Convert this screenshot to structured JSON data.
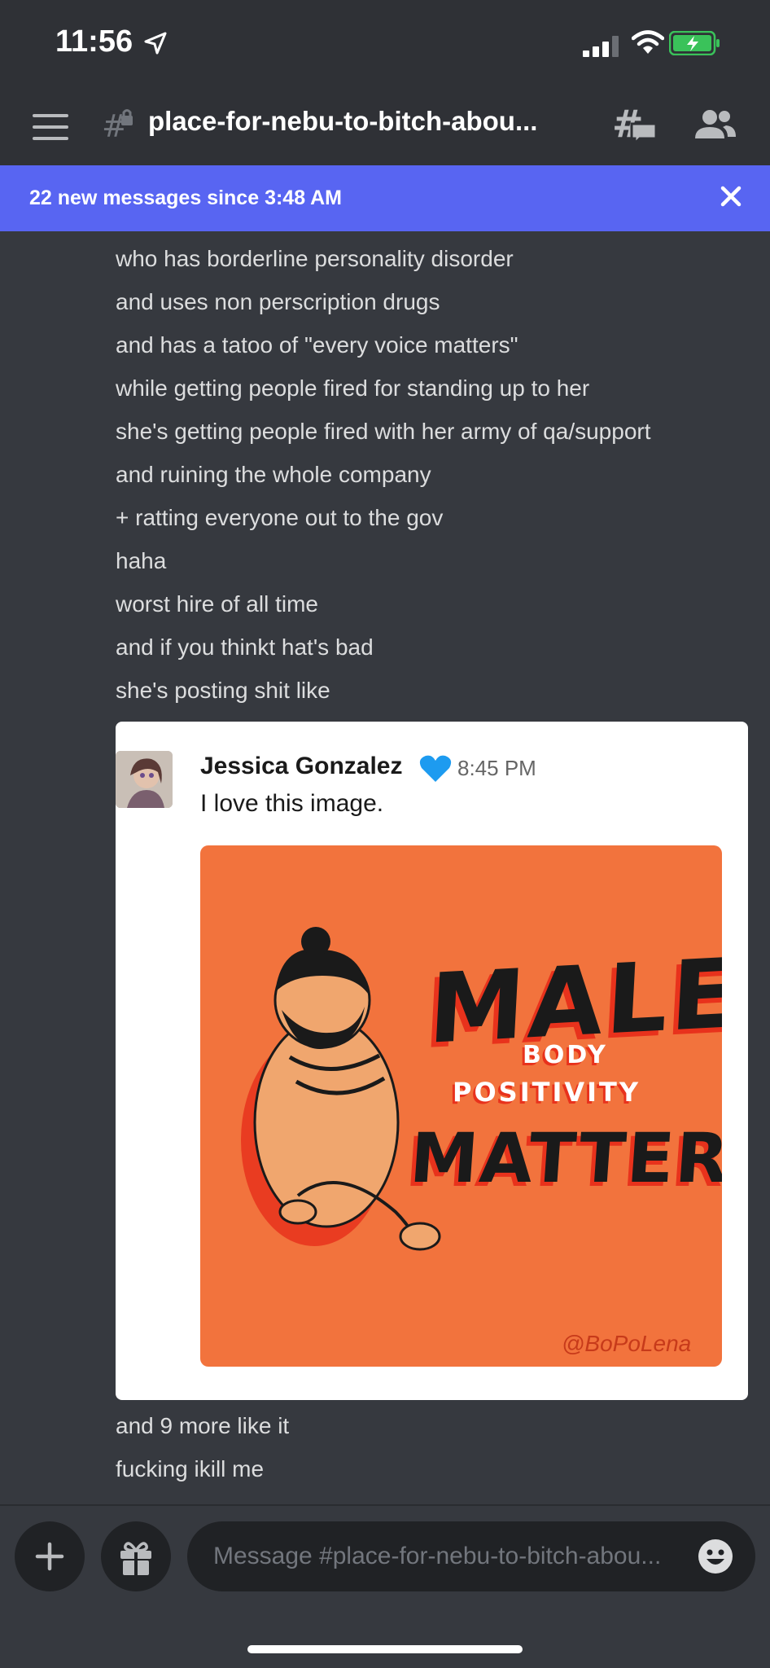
{
  "status_bar": {
    "time": "11:56"
  },
  "header": {
    "channel_title": "place-for-nebu-to-bitch-abou..."
  },
  "banner": {
    "text": "22 new messages since 3:48 AM"
  },
  "messages": [
    "who has borderline personality disorder",
    "and uses non perscription drugs",
    "and has a tatoo of \"every voice matters\"",
    "while getting people fired for standing up to her",
    "she's getting people fired with her army of qa/support",
    "and ruining the whole company",
    "+ ratting everyone out to the gov",
    "haha",
    "worst hire of all time",
    "and if you thinkt hat's bad",
    "she's posting shit like"
  ],
  "embed": {
    "author": "Jessica Gonzalez",
    "time": "8:45 PM",
    "text": "I love this image.",
    "poster": {
      "line1": "MALE",
      "line2": "BODY",
      "line3": "POSITIVITY",
      "line4": "MATTERS",
      "credit": "@BoPoLena"
    }
  },
  "messages_after": [
    "and 9 more like it",
    "fucking ikill me"
  ],
  "composer": {
    "placeholder": "Message #place-for-nebu-to-bitch-abou..."
  },
  "colors": {
    "background": "#36393f",
    "header": "#2f3136",
    "banner": "#5865f2",
    "poster": "#f2733d",
    "battery": "#3ac25a"
  }
}
